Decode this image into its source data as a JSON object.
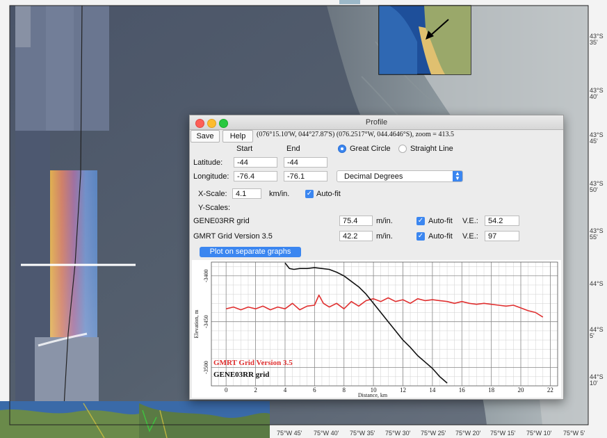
{
  "colors": {
    "accent_blue": "#3b86f0",
    "gmrt_series": "#e03030",
    "gene_series": "#111111"
  },
  "map": {
    "latitude_labels": [
      "43°S 35'",
      "43°S 40'",
      "43°S 45'",
      "43°S 50'",
      "43°S 55'",
      "44°S",
      "44°S 5'",
      "44°S 10'"
    ],
    "longitude_labels": [
      "75°W 45'",
      "75°W 40'",
      "75°W 35'",
      "75°W 30'",
      "75°W 25'",
      "75°W 20'",
      "75°W 15'",
      "75°W 10'",
      "75°W 5'"
    ]
  },
  "dialog": {
    "title": "Profile",
    "save_label": "Save",
    "help_label": "Help",
    "info_text": "(076°15.10'W, 044°27.87'S) (076.2517°W, 044.4646°S), zoom = 413.5",
    "start_header": "Start",
    "end_header": "End",
    "great_circle_label": "Great Circle",
    "straight_line_label": "Straight Line",
    "latitude_label": "Latitude:",
    "latitude_start": "-44",
    "latitude_end": "-44",
    "longitude_label": "Longitude:",
    "longitude_start": "-76.4",
    "longitude_end": "-76.1",
    "coord_format": "Decimal Degrees",
    "xscale_label": "X-Scale:",
    "xscale_value": "4.1",
    "xscale_unit": "km/in.",
    "autofit_label": "Auto-fit",
    "yscales_label": "Y-Scales:",
    "grids": [
      {
        "name": "GENE03RR grid",
        "scale": "75.4",
        "unit": "m/in.",
        "autofit": "Auto-fit",
        "ve_label": "V.E.:",
        "ve": "54.2"
      },
      {
        "name": "GMRT Grid Version 3.5",
        "scale": "42.2",
        "unit": "m/in.",
        "autofit": "Auto-fit",
        "ve_label": "V.E.:",
        "ve": "97"
      }
    ],
    "plot_button_label": "Plot on separate graphs"
  },
  "chart_data": {
    "type": "line",
    "xlabel": "Distance, km",
    "ylabel": "Elevation, m",
    "xlim": [
      -1,
      22.5
    ],
    "ylim": [
      -3520,
      -3385
    ],
    "x_ticks": [
      0,
      2,
      4,
      6,
      8,
      10,
      12,
      14,
      16,
      18,
      20,
      22
    ],
    "y_ticks": [
      -3400,
      -3450,
      -3500
    ],
    "x_tick_labels": [
      "0",
      "2",
      "4",
      "6",
      "8",
      "10",
      "12",
      "14",
      "16",
      "18",
      "20",
      "22"
    ],
    "y_tick_labels": [
      "-3400",
      "-3450",
      "-3500"
    ],
    "grid": true,
    "legend_position": "bottom-left",
    "series": [
      {
        "name": "GMRT Grid Version 3.5",
        "color": "#e03030",
        "x": [
          0,
          0.5,
          1,
          1.5,
          2,
          2.5,
          3,
          3.5,
          4,
          4.5,
          5,
          5.5,
          6,
          6.3,
          6.6,
          7,
          7.5,
          8,
          8.5,
          9,
          9.5,
          10,
          10.5,
          11,
          11.5,
          12,
          12.5,
          13,
          13.5,
          14,
          14.5,
          15,
          15.5,
          16,
          16.5,
          17,
          17.5,
          18,
          18.5,
          19,
          19.5,
          20,
          20.5,
          21,
          21.5
        ],
        "y": [
          -3436,
          -3434,
          -3437,
          -3434,
          -3436,
          -3433,
          -3437,
          -3434,
          -3436,
          -3430,
          -3437,
          -3433,
          -3432,
          -3421,
          -3430,
          -3434,
          -3430,
          -3436,
          -3428,
          -3433,
          -3427,
          -3425,
          -3428,
          -3424,
          -3428,
          -3426,
          -3430,
          -3425,
          -3427,
          -3426,
          -3427,
          -3428,
          -3430,
          -3428,
          -3430,
          -3431,
          -3430,
          -3431,
          -3432,
          -3433,
          -3432,
          -3435,
          -3438,
          -3440,
          -3445
        ]
      },
      {
        "name": "GENE03RR grid",
        "color": "#111111",
        "x": [
          4,
          4.3,
          4.6,
          5,
          5.5,
          6,
          6.5,
          7,
          7.5,
          8,
          8.5,
          9,
          9.5,
          10,
          10.5,
          11,
          11.5,
          12,
          12.5,
          13,
          13.5,
          14,
          14.5,
          15
        ],
        "y": [
          -3386,
          -3392,
          -3393,
          -3392,
          -3392,
          -3391,
          -3392,
          -3393,
          -3396,
          -3400,
          -3406,
          -3412,
          -3420,
          -3430,
          -3440,
          -3450,
          -3460,
          -3470,
          -3478,
          -3487,
          -3494,
          -3501,
          -3510,
          -3517
        ]
      }
    ]
  }
}
